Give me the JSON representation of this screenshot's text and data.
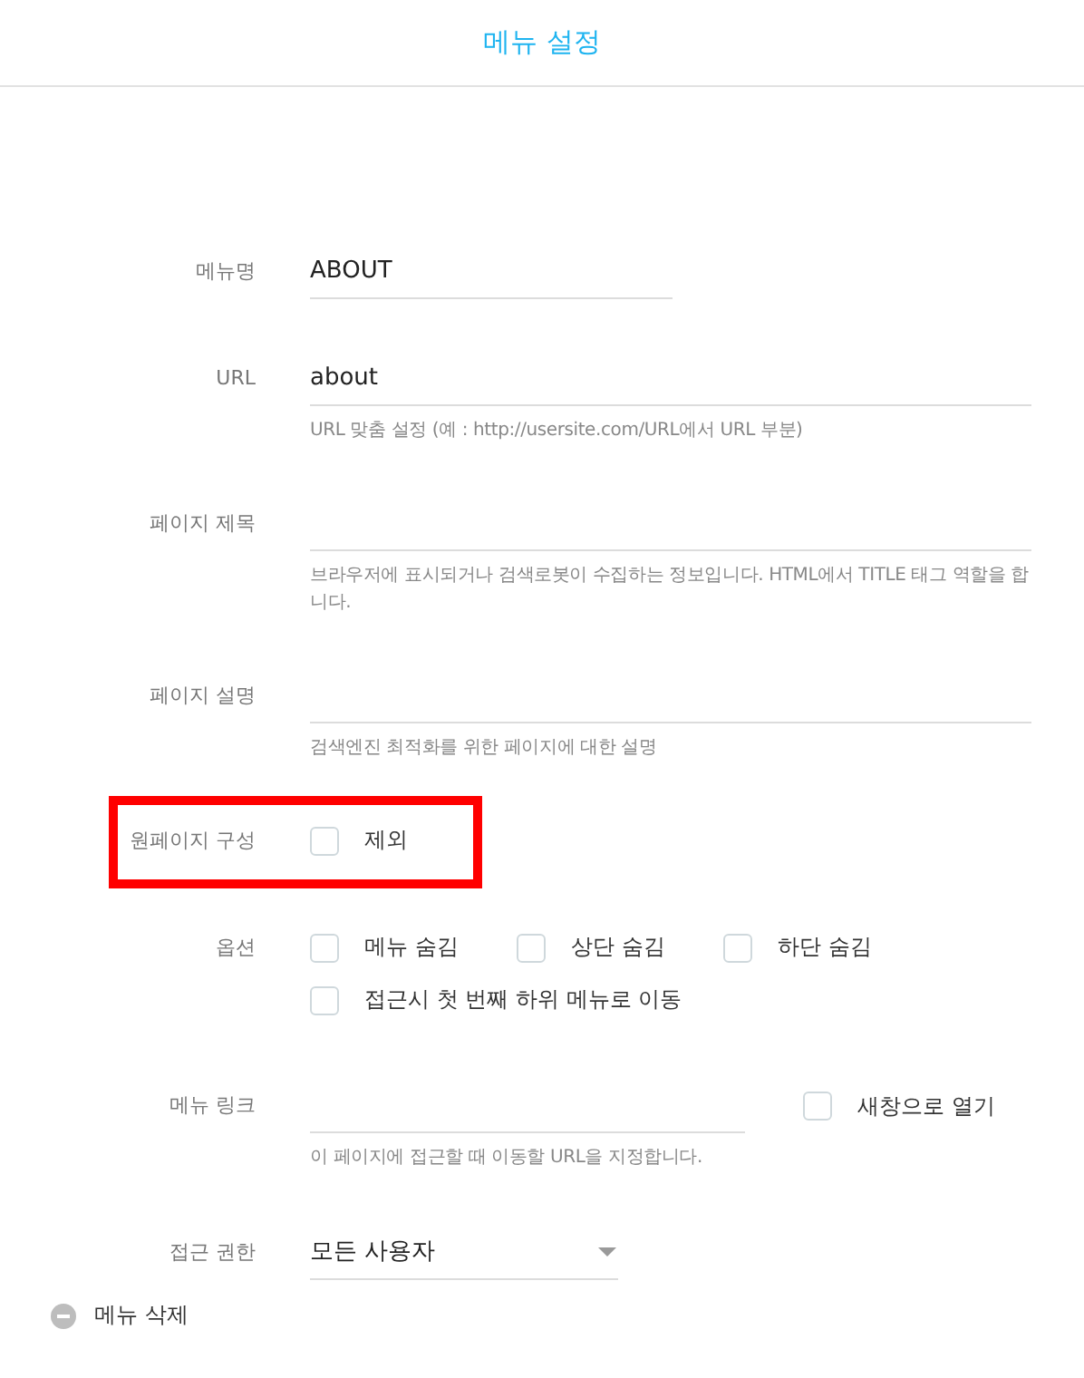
{
  "title": "메뉴 설정",
  "rows": [
    {
      "kind": "text",
      "label": "메뉴명",
      "value": "ABOUT",
      "wide": false
    },
    {
      "kind": "text",
      "label": "URL",
      "value": "about",
      "wide": true,
      "help": "URL 맞춤 설정 (예 : http://usersite.com/URL에서 URL 부분)"
    },
    {
      "kind": "text",
      "label": "페이지 제목",
      "wide": true,
      "help": "브라우저에 표시되거나 검색로봇이 수집하는 정보입니다. HTML에서 TITLE 태그 역할을 합니다."
    },
    {
      "kind": "text",
      "label": "페이지 설명",
      "wide": true,
      "help": "검색엔진 최적화를 위한 페이지에 대한 설명"
    },
    {
      "kind": "checks",
      "label": "원페이지 구성",
      "highlighted": true,
      "options": [
        {
          "label": "제외",
          "checked": false
        }
      ]
    },
    {
      "kind": "checks",
      "label": "옵션",
      "highlighted": false,
      "options": [
        {
          "label": "메뉴 숨김",
          "checked": false
        },
        {
          "label": "상단 숨김",
          "checked": false
        },
        {
          "label": "하단 숨김",
          "checked": false
        },
        {
          "label": "접근시 첫 번째 하위 메뉴로 이동",
          "checked": false
        }
      ]
    },
    {
      "kind": "link",
      "label": "메뉴 링크",
      "help": "이 페이지에 접근할 때 이동할 URL을 지정합니다.",
      "option": {
        "label": "새창으로 열기",
        "checked": false
      }
    },
    {
      "kind": "select",
      "label": "접근 권한",
      "value": "모든 사용자"
    }
  ],
  "delete": {
    "label": "메뉴 삭제"
  }
}
